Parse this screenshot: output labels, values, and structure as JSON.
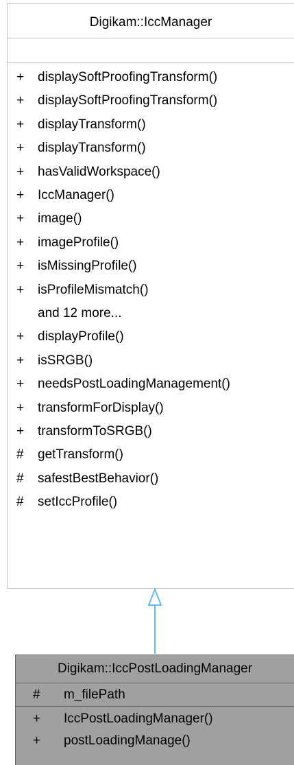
{
  "parent_class": {
    "name": "Digikam::IccManager",
    "members": [
      {
        "vis": "+",
        "name": "displaySoftProofingTransform()"
      },
      {
        "vis": "+",
        "name": "displaySoftProofingTransform()"
      },
      {
        "vis": "+",
        "name": "displayTransform()"
      },
      {
        "vis": "+",
        "name": "displayTransform()"
      },
      {
        "vis": "+",
        "name": "hasValidWorkspace()"
      },
      {
        "vis": "+",
        "name": "IccManager()"
      },
      {
        "vis": "+",
        "name": "image()"
      },
      {
        "vis": "+",
        "name": "imageProfile()"
      },
      {
        "vis": "+",
        "name": "isMissingProfile()"
      },
      {
        "vis": "+",
        "name": "isProfileMismatch()"
      },
      {
        "vis": "",
        "name": "and 12 more..."
      },
      {
        "vis": "+",
        "name": "displayProfile()"
      },
      {
        "vis": "+",
        "name": "isSRGB()"
      },
      {
        "vis": "+",
        "name": "needsPostLoadingManagement()"
      },
      {
        "vis": "+",
        "name": "transformForDisplay()"
      },
      {
        "vis": "+",
        "name": "transformToSRGB()"
      },
      {
        "vis": "#",
        "name": "getTransform()"
      },
      {
        "vis": "#",
        "name": "safestBestBehavior()"
      },
      {
        "vis": "#",
        "name": "setIccProfile()"
      }
    ]
  },
  "child_class": {
    "name": "Digikam::IccPostLoadingManager",
    "attributes": [
      {
        "vis": "#",
        "name": "m_filePath"
      }
    ],
    "methods": [
      {
        "vis": "+",
        "name": "IccPostLoadingManager()"
      },
      {
        "vis": "+",
        "name": "postLoadingManage()"
      }
    ]
  },
  "colors": {
    "arrow": "#63b8ff",
    "child_bg": "#a0a0a0",
    "border": "#c2c2c2"
  }
}
